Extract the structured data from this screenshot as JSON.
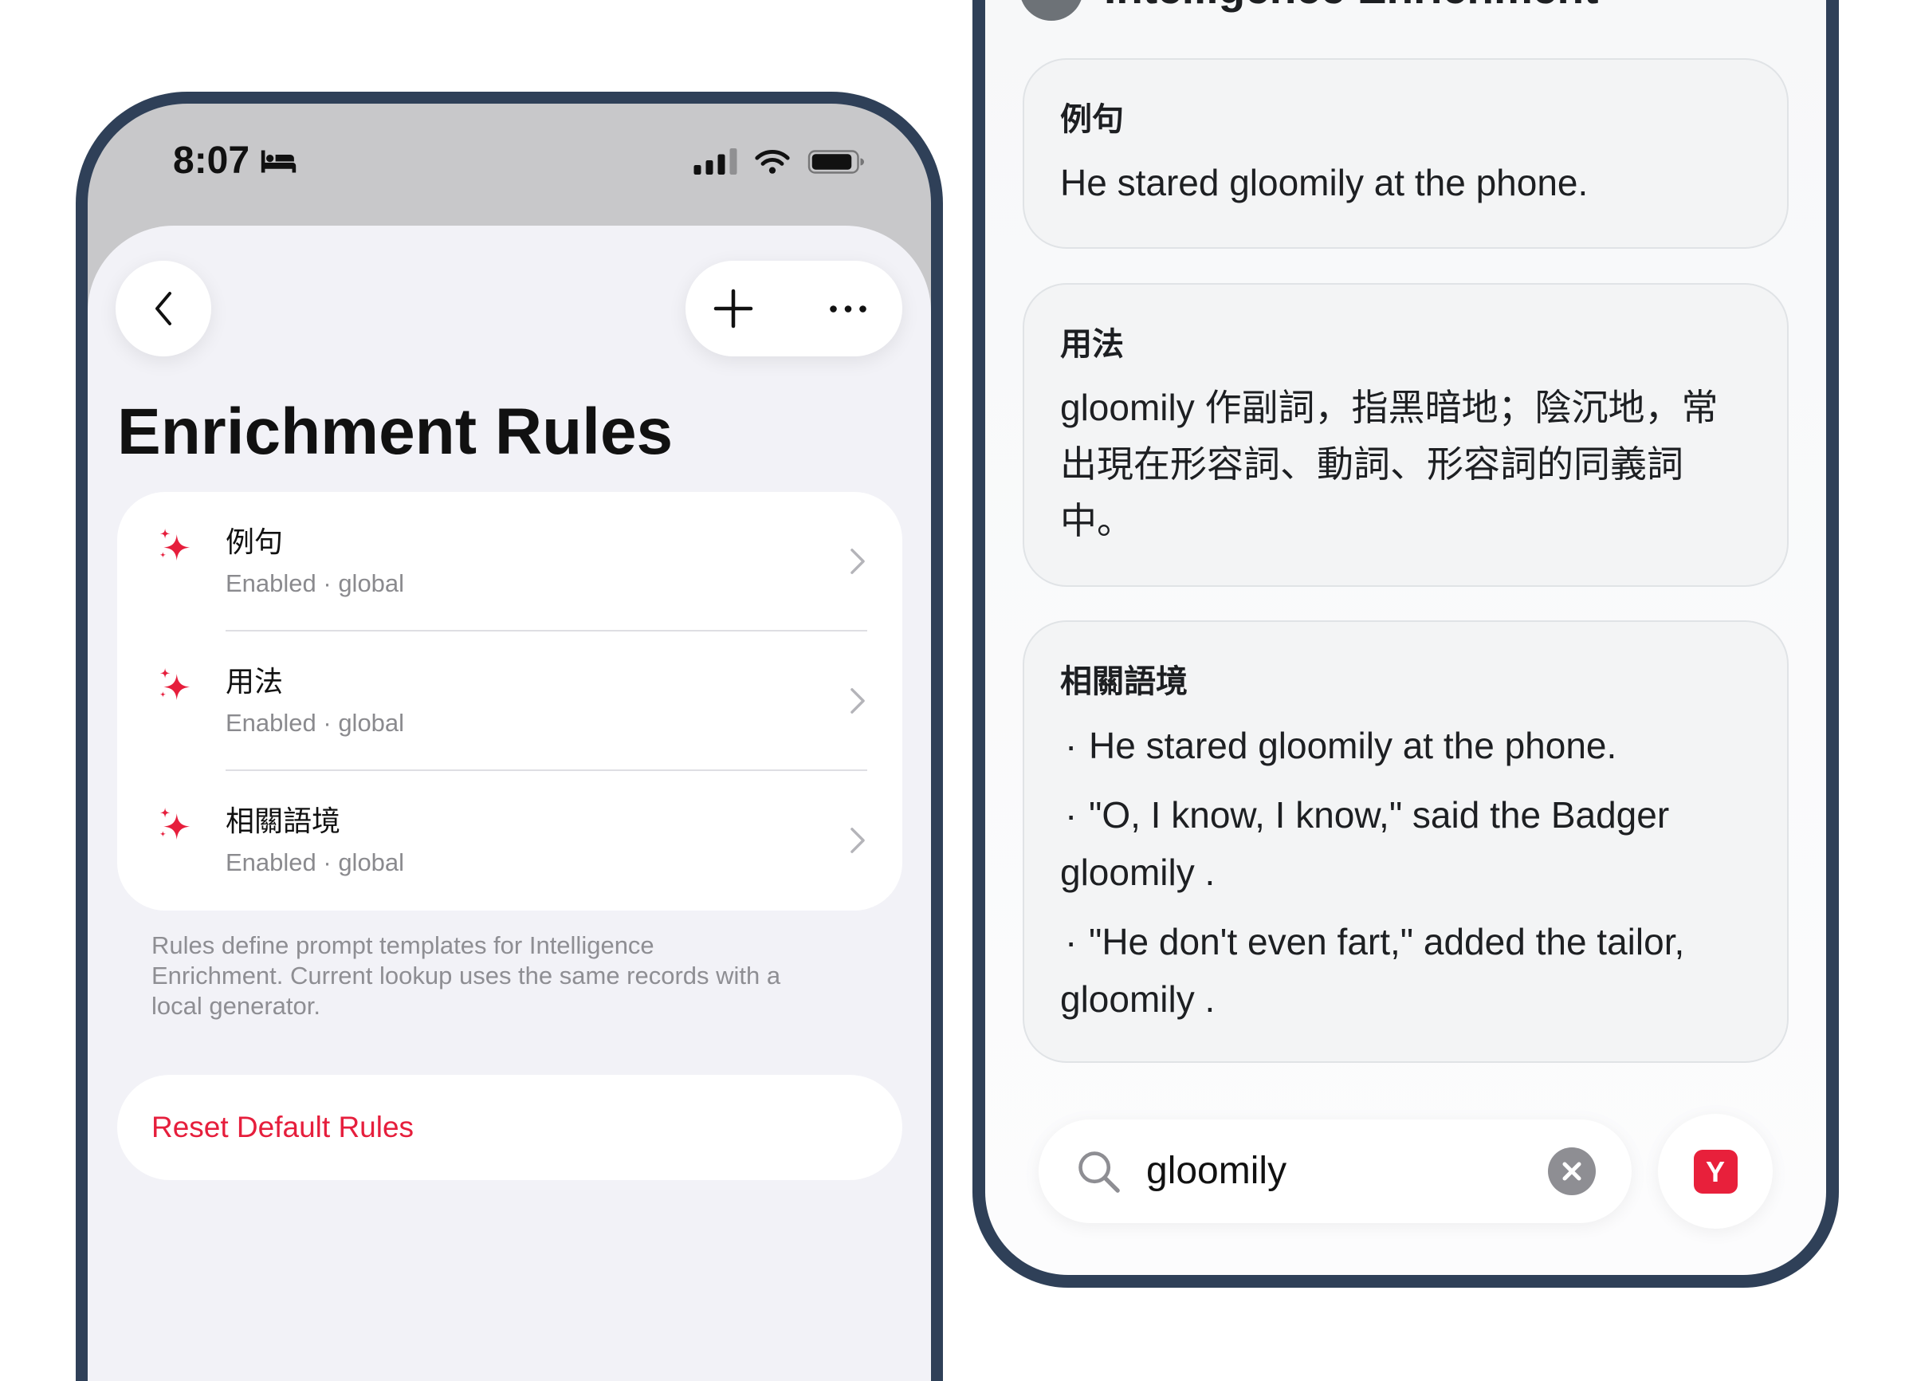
{
  "colors": {
    "frame": "#2f4058",
    "accent": "#e61e3c",
    "sheet_bg": "#f2f2f7",
    "secondary_text": "#8a8a8e",
    "card_bg": "#f3f4f5"
  },
  "rules_screen": {
    "status_bar": {
      "time": "8:07",
      "icons": {
        "focus": "bed-icon",
        "cellular": "cellular-signal-icon",
        "wifi": "wifi-icon",
        "battery": "battery-icon"
      }
    },
    "nav": {
      "back_icon": "chevron-left-icon",
      "add_icon": "plus-icon",
      "more_icon": "ellipsis-icon"
    },
    "title": "Enrichment Rules",
    "rules": [
      {
        "name": "例句",
        "subtitle": "Enabled · global",
        "icon": "sparkles-icon"
      },
      {
        "name": "用法",
        "subtitle": "Enabled · global",
        "icon": "sparkles-icon"
      },
      {
        "name": "相關語境",
        "subtitle": "Enabled · global",
        "icon": "sparkles-icon"
      }
    ],
    "footer_lines": [
      "Rules define prompt templates for Intelligence",
      "Enrichment. Current lookup uses the same records with a",
      "local generator."
    ],
    "reset_label": "Reset Default Rules"
  },
  "lookup_screen": {
    "header_title": "Intelligence Enrichment",
    "sections": [
      {
        "label": "例句",
        "lines": [
          "He stared gloomily at the phone."
        ]
      },
      {
        "label": "用法",
        "lines": [
          "gloomily 作副詞，指黑暗地；陰沉地，常",
          "出現在形容詞、動詞、形容詞的同義詞",
          "中。"
        ]
      },
      {
        "label": "相關語境",
        "bullet": "·",
        "items": [
          [
            "He stared gloomily at the phone."
          ],
          [
            "\"O, I know, I know,\" said the Badger",
            "gloomily ."
          ],
          [
            "\"He don't even fart,\" added the tailor,",
            "gloomily ."
          ]
        ]
      }
    ],
    "search": {
      "value": "gloomily",
      "search_icon": "magnifying-glass-icon",
      "clear_icon": "clear-icon"
    },
    "dictionary_button": {
      "logo_text": "Y",
      "icon": "dictionary-logo-icon"
    }
  }
}
